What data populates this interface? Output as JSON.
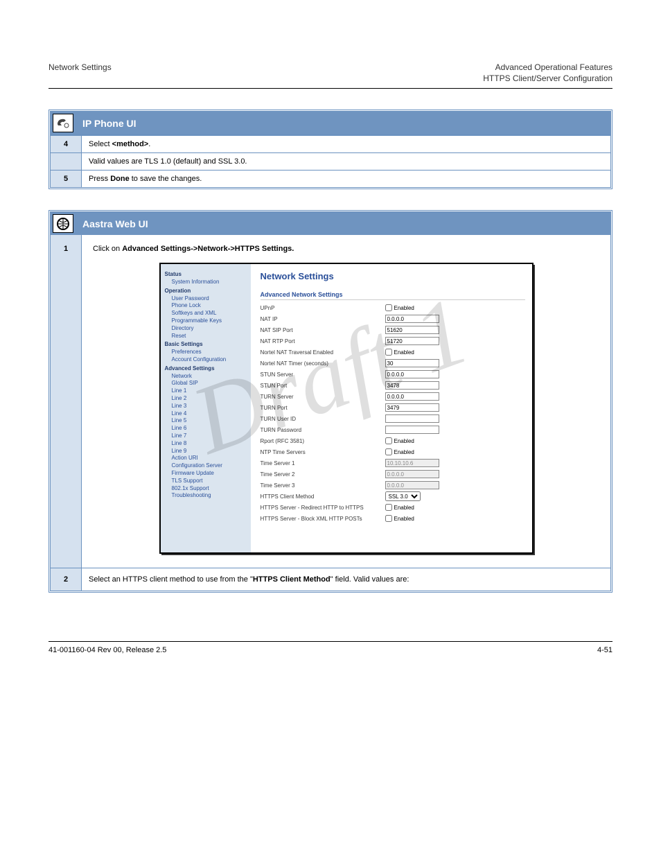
{
  "watermark": "Draft 1",
  "header": {
    "left": "Network Settings",
    "right1": "Advanced Operational Features",
    "right2": "HTTPS Client/Server Configuration"
  },
  "phone_ui": {
    "title": "IP Phone UI",
    "steps": [
      {
        "n": "4",
        "t": "Select <method>."
      },
      {
        "n": "5",
        "t": "Press Done to save the changes."
      }
    ],
    "after": "Valid values are TLS 1.0 (default) and SSL 3.0."
  },
  "web_ui": {
    "title": "Aastra Web UI",
    "step1_num": "1",
    "step1_txt": "Click on Advanced Settings->Network->HTTPS Settings.",
    "step2_num": "2",
    "step2_txt": "Select an HTTPS client method to use from the \"HTTPS Client Method\" field. Valid values are:"
  },
  "screenshot": {
    "menu": {
      "status": "Status",
      "sysinfo": "System Information",
      "operation": "Operation",
      "op_items": [
        "User Password",
        "Phone Lock",
        "Softkeys and XML",
        "Programmable Keys",
        "Directory",
        "Reset"
      ],
      "basic": "Basic Settings",
      "bs_items": [
        "Preferences",
        "Account Configuration"
      ],
      "advanced": "Advanced Settings",
      "adv_items": [
        "Network",
        "Global SIP",
        "Line 1",
        "Line 2",
        "Line 3",
        "Line 4",
        "Line 5",
        "Line 6",
        "Line 7",
        "Line 8",
        "Line 9",
        "Action URI",
        "Configuration Server",
        "Firmware Update",
        "TLS Support",
        "802.1x Support",
        "Troubleshooting"
      ]
    },
    "panel": {
      "title": "Network Settings",
      "subhead": "Advanced Network Settings",
      "rows": [
        {
          "label": "UPnP",
          "type": "chk",
          "val": "Enabled"
        },
        {
          "label": "NAT IP",
          "type": "text",
          "val": "0.0.0.0"
        },
        {
          "label": "NAT SIP Port",
          "type": "text",
          "val": "51620"
        },
        {
          "label": "NAT RTP Port",
          "type": "text",
          "val": "51720"
        },
        {
          "label": "Nortel NAT Traversal Enabled",
          "type": "chk",
          "val": "Enabled"
        },
        {
          "label": "Nortel NAT Timer (seconds)",
          "type": "text",
          "val": "30"
        },
        {
          "label": "STUN Server",
          "type": "text",
          "val": "0.0.0.0"
        },
        {
          "label": "STUN Port",
          "type": "text",
          "val": "3478"
        },
        {
          "label": "TURN Server",
          "type": "text",
          "val": "0.0.0.0"
        },
        {
          "label": "TURN Port",
          "type": "text",
          "val": "3479"
        },
        {
          "label": "TURN User ID",
          "type": "text",
          "val": ""
        },
        {
          "label": "TURN Password",
          "type": "text",
          "val": ""
        },
        {
          "label": "Rport (RFC 3581)",
          "type": "chk",
          "val": "Enabled"
        },
        {
          "label": "NTP Time Servers",
          "type": "chk",
          "val": "Enabled"
        },
        {
          "label": "Time Server 1",
          "type": "textd",
          "val": "10.10.10.6"
        },
        {
          "label": "Time Server 2",
          "type": "textd",
          "val": "0.0.0.0"
        },
        {
          "label": "Time Server 3",
          "type": "textd",
          "val": "0.0.0.0"
        },
        {
          "label": "HTTPS Client Method",
          "type": "select",
          "val": "SSL 3.0"
        },
        {
          "label": "HTTPS Server - Redirect HTTP to HTTPS",
          "type": "chk",
          "val": "Enabled"
        },
        {
          "label": "HTTPS Server - Block XML HTTP POSTs",
          "type": "chk",
          "val": "Enabled"
        }
      ]
    }
  },
  "footer": {
    "left": "41-001160-04 Rev 00, Release 2.5",
    "right": "4-51"
  }
}
